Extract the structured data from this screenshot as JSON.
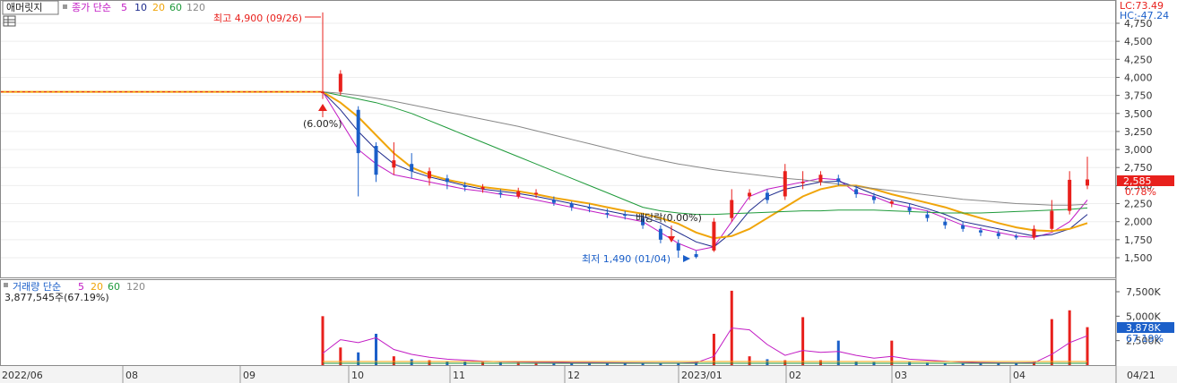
{
  "instrument_tab": "애머릿지",
  "price_panel": {
    "legend": {
      "prefix": "종가 단순",
      "ma": [
        "5",
        "10",
        "20",
        "60",
        "120"
      ]
    },
    "lc_label": "LC:73.49",
    "hc_label": "HC:-47.24",
    "high_annotation": "최고 4,900 (09/26)",
    "low_annotation": "최저 1,490 (01/04)",
    "pct_annotation": "(6.00%)",
    "dividend_annotation": "배당락(0.00%)",
    "current_price": "2,585",
    "current_change": "0.78%"
  },
  "volume_panel": {
    "legend": {
      "prefix": "거래량 단순",
      "ma": [
        "5",
        "20",
        "60",
        "120"
      ]
    },
    "info": "3,877,545주(67.19%)",
    "current_volume": "3,878K",
    "current_pct": "67.19%"
  },
  "colors": {
    "up": "#e8201c",
    "down": "#1b5fc9",
    "ma5": "#c21bc4",
    "ma10": "#1d2a8c",
    "ma20": "#f0a50a",
    "ma60": "#1e9a3a",
    "ma120": "#888888"
  },
  "chart_data": [
    {
      "type": "candlestick",
      "ylim": [
        1250,
        5000
      ],
      "y_ticks": [
        "1,500",
        "1,750",
        "2,000",
        "2,250",
        "2,500",
        "2,750",
        "3,000",
        "3,250",
        "3,500",
        "3,750",
        "4,000",
        "4,250",
        "4,500",
        "4,750"
      ],
      "x_ticks": [
        "2022/06",
        "08",
        "09",
        "10",
        "11",
        "12",
        "2023/01",
        "02",
        "03",
        "04",
        "04/21"
      ],
      "flat_price_before_listing": 3800,
      "series": [
        {
          "name": "5",
          "values": [
            3800,
            3400,
            3000,
            2800,
            2650,
            2600,
            2550,
            2500,
            2450,
            2420,
            2380,
            2350,
            2300,
            2250,
            2200,
            2150,
            2100,
            2050,
            2000,
            1850,
            1700,
            1600,
            1650,
            2000,
            2350,
            2450,
            2500,
            2550,
            2600,
            2580,
            2400,
            2350,
            2250,
            2200,
            2150,
            2050,
            1950,
            1900,
            1850,
            1800,
            1780,
            1850,
            2000,
            2300
          ]
        },
        {
          "name": "10",
          "values": [
            3800,
            3550,
            3250,
            3000,
            2800,
            2700,
            2620,
            2560,
            2500,
            2450,
            2420,
            2390,
            2350,
            2300,
            2250,
            2200,
            2150,
            2100,
            2070,
            1980,
            1850,
            1720,
            1650,
            1850,
            2150,
            2350,
            2450,
            2500,
            2550,
            2560,
            2480,
            2380,
            2300,
            2250,
            2180,
            2100,
            2000,
            1950,
            1900,
            1850,
            1800,
            1820,
            1900,
            2100
          ]
        },
        {
          "name": "20",
          "values": [
            3800,
            3650,
            3450,
            3200,
            2950,
            2750,
            2650,
            2580,
            2530,
            2480,
            2450,
            2420,
            2380,
            2330,
            2290,
            2250,
            2200,
            2150,
            2110,
            2050,
            1970,
            1850,
            1770,
            1800,
            1900,
            2050,
            2200,
            2350,
            2450,
            2500,
            2500,
            2450,
            2380,
            2320,
            2260,
            2200,
            2120,
            2050,
            1980,
            1920,
            1880,
            1870,
            1900,
            1980
          ]
        },
        {
          "name": "60",
          "values": [
            3800,
            3750,
            3700,
            3650,
            3580,
            3500,
            3400,
            3300,
            3200,
            3100,
            3000,
            2900,
            2800,
            2700,
            2600,
            2500,
            2400,
            2300,
            2200,
            2150,
            2120,
            2100,
            2100,
            2110,
            2120,
            2130,
            2140,
            2150,
            2150,
            2160,
            2160,
            2160,
            2150,
            2140,
            2130,
            2120,
            2120,
            2120,
            2130,
            2140,
            2150,
            2160,
            2170,
            2190
          ]
        },
        {
          "name": "120",
          "values": [
            3800,
            3780,
            3750,
            3710,
            3670,
            3620,
            3570,
            3520,
            3470,
            3420,
            3370,
            3320,
            3260,
            3200,
            3140,
            3080,
            3020,
            2960,
            2900,
            2850,
            2800,
            2760,
            2720,
            2690,
            2660,
            2630,
            2600,
            2580,
            2550,
            2520,
            2490,
            2460,
            2430,
            2400,
            2370,
            2340,
            2310,
            2290,
            2270,
            2250,
            2240,
            2230,
            2230,
            2240
          ]
        }
      ],
      "candles": [
        {
          "o": 3800,
          "c": 3800,
          "h": 4900,
          "l": 3700
        },
        {
          "o": 3800,
          "c": 4050,
          "h": 4100,
          "l": 3750
        },
        {
          "o": 3550,
          "c": 2950,
          "h": 3600,
          "l": 2350
        },
        {
          "o": 3050,
          "c": 2650,
          "h": 3100,
          "l": 2550
        },
        {
          "o": 2750,
          "c": 2850,
          "h": 3100,
          "l": 2650
        },
        {
          "o": 2800,
          "c": 2700,
          "h": 2950,
          "l": 2600
        },
        {
          "o": 2600,
          "c": 2700,
          "h": 2750,
          "l": 2500
        },
        {
          "o": 2600,
          "c": 2550,
          "h": 2650,
          "l": 2450
        },
        {
          "o": 2500,
          "c": 2480,
          "h": 2550,
          "l": 2420
        },
        {
          "o": 2450,
          "c": 2480,
          "h": 2520,
          "l": 2400
        },
        {
          "o": 2400,
          "c": 2380,
          "h": 2450,
          "l": 2330
        },
        {
          "o": 2350,
          "c": 2420,
          "h": 2470,
          "l": 2320
        },
        {
          "o": 2380,
          "c": 2400,
          "h": 2450,
          "l": 2330
        },
        {
          "o": 2300,
          "c": 2260,
          "h": 2350,
          "l": 2220
        },
        {
          "o": 2250,
          "c": 2200,
          "h": 2280,
          "l": 2150
        },
        {
          "o": 2200,
          "c": 2180,
          "h": 2250,
          "l": 2130
        },
        {
          "o": 2120,
          "c": 2100,
          "h": 2180,
          "l": 2050
        },
        {
          "o": 2100,
          "c": 2080,
          "h": 2150,
          "l": 2030
        },
        {
          "o": 2050,
          "c": 1950,
          "h": 2100,
          "l": 1900
        },
        {
          "o": 1900,
          "c": 1750,
          "h": 1950,
          "l": 1700
        },
        {
          "o": 1700,
          "c": 1600,
          "h": 1750,
          "l": 1500
        },
        {
          "o": 1550,
          "c": 1510,
          "h": 1600,
          "l": 1490
        },
        {
          "o": 1600,
          "c": 2000,
          "h": 2050,
          "l": 1580
        },
        {
          "o": 2050,
          "c": 2300,
          "h": 2450,
          "l": 2000
        },
        {
          "o": 2350,
          "c": 2400,
          "h": 2450,
          "l": 2300
        },
        {
          "o": 2400,
          "c": 2300,
          "h": 2450,
          "l": 2250
        },
        {
          "o": 2350,
          "c": 2700,
          "h": 2800,
          "l": 2300
        },
        {
          "o": 2550,
          "c": 2550,
          "h": 2700,
          "l": 2450
        },
        {
          "o": 2550,
          "c": 2650,
          "h": 2700,
          "l": 2500
        },
        {
          "o": 2600,
          "c": 2550,
          "h": 2650,
          "l": 2500
        },
        {
          "o": 2450,
          "c": 2380,
          "h": 2500,
          "l": 2330
        },
        {
          "o": 2350,
          "c": 2300,
          "h": 2400,
          "l": 2250
        },
        {
          "o": 2250,
          "c": 2280,
          "h": 2300,
          "l": 2200
        },
        {
          "o": 2200,
          "c": 2150,
          "h": 2250,
          "l": 2100
        },
        {
          "o": 2100,
          "c": 2050,
          "h": 2150,
          "l": 2000
        },
        {
          "o": 2000,
          "c": 1950,
          "h": 2050,
          "l": 1900
        },
        {
          "o": 1950,
          "c": 1900,
          "h": 2000,
          "l": 1860
        },
        {
          "o": 1880,
          "c": 1850,
          "h": 1920,
          "l": 1800
        },
        {
          "o": 1840,
          "c": 1800,
          "h": 1880,
          "l": 1760
        },
        {
          "o": 1800,
          "c": 1780,
          "h": 1830,
          "l": 1750
        },
        {
          "o": 1780,
          "c": 1900,
          "h": 1950,
          "l": 1750
        },
        {
          "o": 1900,
          "c": 2150,
          "h": 2300,
          "l": 1880
        },
        {
          "o": 2150,
          "c": 2580,
          "h": 2700,
          "l": 2100
        },
        {
          "o": 2500,
          "c": 2585,
          "h": 2900,
          "l": 2450
        }
      ]
    },
    {
      "type": "bar",
      "ylim": [
        0,
        8500000
      ],
      "y_ticks": [
        "2,500K",
        "5,000K",
        "7,500K"
      ],
      "series": [
        {
          "name": "거래량",
          "values": [
            5000000,
            1800000,
            1300000,
            3200000,
            900000,
            600000,
            500000,
            400000,
            350000,
            300000,
            280000,
            260000,
            240000,
            220000,
            200000,
            200000,
            190000,
            180000,
            170000,
            160000,
            150000,
            300000,
            3200000,
            7600000,
            900000,
            600000,
            500000,
            4900000,
            500000,
            2500000,
            400000,
            300000,
            2500000,
            300000,
            250000,
            220000,
            200000,
            190000,
            180000,
            170000,
            300000,
            4700000,
            5600000,
            3877545
          ]
        },
        {
          "name": "5",
          "values": [
            1200000,
            2600000,
            2300000,
            2800000,
            1600000,
            1100000,
            800000,
            600000,
            500000,
            400000,
            350000,
            320000,
            300000,
            280000,
            260000,
            250000,
            240000,
            230000,
            220000,
            210000,
            200000,
            250000,
            900000,
            3800000,
            3600000,
            2100000,
            1000000,
            1500000,
            1300000,
            1400000,
            1000000,
            700000,
            900000,
            600000,
            500000,
            400000,
            300000,
            250000,
            230000,
            220000,
            240000,
            1100000,
            2300000,
            3000000
          ]
        }
      ]
    }
  ]
}
